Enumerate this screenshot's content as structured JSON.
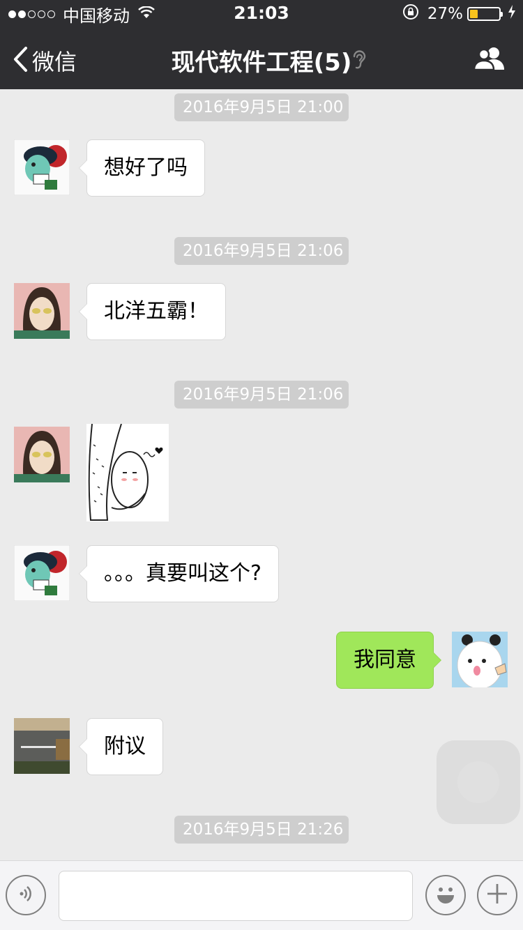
{
  "status_bar": {
    "carrier": "中国移动",
    "time": "21:03",
    "battery": "27%",
    "battery_level": 0.27,
    "icons": [
      "signal-dots-icon",
      "wifi-icon",
      "rotation-lock-icon",
      "battery-icon",
      "charging-icon"
    ]
  },
  "nav": {
    "back_label": "微信",
    "title": "现代软件工程(5)",
    "icons": [
      "back-chevron-icon",
      "ear-icon",
      "group-members-icon"
    ]
  },
  "messages": [
    {
      "type": "timestamp",
      "text": "2016年9月5日 21:00"
    },
    {
      "type": "text",
      "side": "left",
      "text": "想好了吗",
      "avatar": "avatar-cartoon"
    },
    {
      "type": "timestamp",
      "text": "2016年9月5日 21:06"
    },
    {
      "type": "text",
      "side": "left",
      "text": "北洋五霸！",
      "avatar": "avatar-woman"
    },
    {
      "type": "timestamp",
      "text": "2016年9月5日 21:06"
    },
    {
      "type": "sticker",
      "side": "left",
      "sticker": "hugging-leg-sticker",
      "avatar": "avatar-woman"
    },
    {
      "type": "text",
      "side": "left",
      "text": "。。。真要叫这个?",
      "avatar": "avatar-cartoon"
    },
    {
      "type": "text",
      "side": "right",
      "text": "我同意",
      "avatar": "avatar-panda"
    },
    {
      "type": "text",
      "side": "left",
      "text": "附议",
      "avatar": "avatar-room"
    },
    {
      "type": "timestamp",
      "text": "2016年9月5日 21:26"
    }
  ],
  "input_bar": {
    "icons": [
      "voice-icon",
      "emoji-icon",
      "plus-icon"
    ],
    "input_value": ""
  },
  "colors": {
    "nav_bg": "#2e2e31",
    "chat_bg": "#ebebeb",
    "bubble_self": "#a0e75a",
    "bubble_other": "#ffffff",
    "timestamp_bg": "#cecece",
    "battery_fill": "#f7c31d"
  }
}
